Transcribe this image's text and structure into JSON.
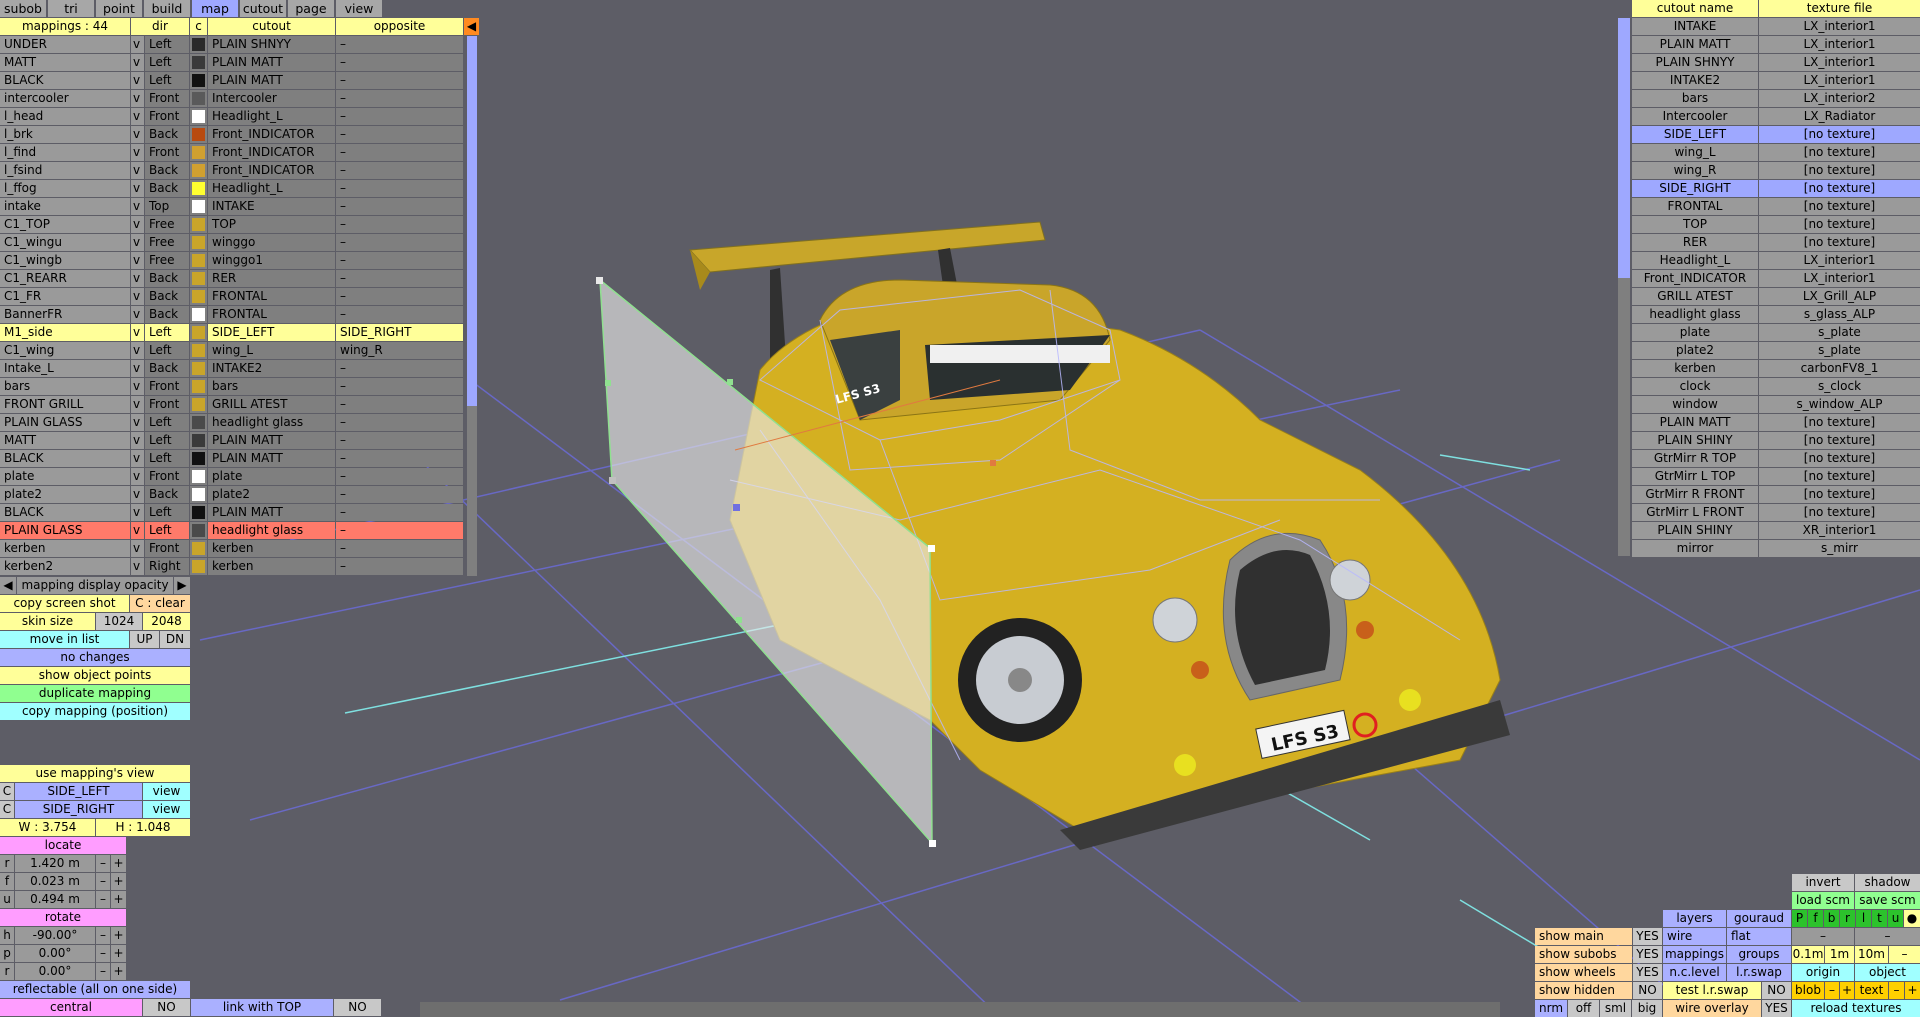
{
  "menu": {
    "tabs": [
      "subob",
      "tri",
      "point",
      "build",
      "map",
      "cutout",
      "page",
      "view"
    ],
    "active": "map"
  },
  "mappings": {
    "header": {
      "count": "mappings : 44",
      "dir": "dir",
      "c": "c",
      "cutout": "cutout",
      "opposite": "opposite"
    },
    "rows": [
      {
        "name": "UNDER",
        "v": "v",
        "dir": "Left",
        "color": "#2a2a2a",
        "cutout": "PLAIN SHNYY",
        "opp": "–"
      },
      {
        "name": "MATT",
        "v": "v",
        "dir": "Left",
        "color": "#3a3a3a",
        "cutout": "PLAIN MATT",
        "opp": "–"
      },
      {
        "name": "BLACK",
        "v": "v",
        "dir": "Left",
        "color": "#111111",
        "cutout": "PLAIN MATT",
        "opp": "–"
      },
      {
        "name": "intercooler",
        "v": "v",
        "dir": "Front",
        "color": "#5a5a5a",
        "cutout": "Intercooler",
        "opp": "–"
      },
      {
        "name": "l_head",
        "v": "v",
        "dir": "Front",
        "color": "#ffffff",
        "cutout": "Headlight_L",
        "opp": "–"
      },
      {
        "name": "l_brk",
        "v": "v",
        "dir": "Back",
        "color": "#b84a10",
        "cutout": "Front_INDICATOR",
        "opp": "–"
      },
      {
        "name": "l_find",
        "v": "v",
        "dir": "Front",
        "color": "#d0a030",
        "cutout": "Front_INDICATOR",
        "opp": "–"
      },
      {
        "name": "l_fsind",
        "v": "v",
        "dir": "Back",
        "color": "#d0a030",
        "cutout": "Front_INDICATOR",
        "opp": "–"
      },
      {
        "name": "l_ffog",
        "v": "v",
        "dir": "Back",
        "color": "#ffff30",
        "cutout": "Headlight_L",
        "opp": "–"
      },
      {
        "name": "intake",
        "v": "v",
        "dir": "Top",
        "color": "#ffffff",
        "cutout": "INTAKE",
        "opp": "–"
      },
      {
        "name": "C1_TOP",
        "v": "v",
        "dir": "Free",
        "color": "#c9a52a",
        "cutout": "TOP",
        "opp": "–"
      },
      {
        "name": "C1_wingu",
        "v": "v",
        "dir": "Free",
        "color": "#c9a52a",
        "cutout": "winggo",
        "opp": "–"
      },
      {
        "name": "C1_wingb",
        "v": "v",
        "dir": "Free",
        "color": "#c9a52a",
        "cutout": "winggo1",
        "opp": "–"
      },
      {
        "name": "C1_REARR",
        "v": "v",
        "dir": "Back",
        "color": "#c9a52a",
        "cutout": "RER",
        "opp": "–"
      },
      {
        "name": "C1_FR",
        "v": "v",
        "dir": "Back",
        "color": "#c9a52a",
        "cutout": "FRONTAL",
        "opp": "–"
      },
      {
        "name": "BannerFR",
        "v": "v",
        "dir": "Back",
        "color": "#ffffff",
        "cutout": "FRONTAL",
        "opp": "–"
      },
      {
        "name": "M1_side",
        "v": "v",
        "dir": "Left",
        "color": "#c9a52a",
        "cutout": "SIDE_LEFT",
        "opp": "SIDE_RIGHT",
        "hl": "yellow"
      },
      {
        "name": "C1_wing",
        "v": "v",
        "dir": "Left",
        "color": "#c9a52a",
        "cutout": "wing_L",
        "opp": "wing_R"
      },
      {
        "name": "Intake_L",
        "v": "v",
        "dir": "Back",
        "color": "#c9a52a",
        "cutout": "INTAKE2",
        "opp": "–"
      },
      {
        "name": "bars",
        "v": "v",
        "dir": "Front",
        "color": "#c9a52a",
        "cutout": "bars",
        "opp": "–"
      },
      {
        "name": "FRONT GRILL",
        "v": "v",
        "dir": "Front",
        "color": "#c9a52a",
        "cutout": "GRILL ATEST",
        "opp": "–"
      },
      {
        "name": "PLAIN GLASS",
        "v": "v",
        "dir": "Left",
        "color": "#4a4a4a",
        "cutout": "headlight glass",
        "opp": "–"
      },
      {
        "name": "MATT",
        "v": "v",
        "dir": "Left",
        "color": "#3a3a3a",
        "cutout": "PLAIN MATT",
        "opp": "–"
      },
      {
        "name": "BLACK",
        "v": "v",
        "dir": "Left",
        "color": "#111111",
        "cutout": "PLAIN MATT",
        "opp": "–"
      },
      {
        "name": "plate",
        "v": "v",
        "dir": "Front",
        "color": "#ffffff",
        "cutout": "plate",
        "opp": "–"
      },
      {
        "name": "plate2",
        "v": "v",
        "dir": "Back",
        "color": "#ffffff",
        "cutout": "plate2",
        "opp": "–"
      },
      {
        "name": "BLACK",
        "v": "v",
        "dir": "Left",
        "color": "#111111",
        "cutout": "PLAIN MATT",
        "opp": "–"
      },
      {
        "name": "PLAIN GLASS",
        "v": "v",
        "dir": "Left",
        "color": "#4a4a4a",
        "cutout": "headlight glass",
        "opp": "–",
        "hl": "red"
      },
      {
        "name": "kerben",
        "v": "v",
        "dir": "Front",
        "color": "#c9a52a",
        "cutout": "kerben",
        "opp": "–"
      },
      {
        "name": "kerben2",
        "v": "v",
        "dir": "Right",
        "color": "#c9a52a",
        "cutout": "kerben",
        "opp": "–"
      }
    ]
  },
  "left_panel": {
    "opacity_label": "mapping display opacity",
    "copy_screen_shot": "copy screen shot",
    "c_clear": "C : clear",
    "skin_size": "skin size",
    "skin_1024": "1024",
    "skin_2048": "2048",
    "move_in_list": "move in list",
    "up": "UP",
    "dn": "DN",
    "no_changes": "no changes",
    "show_object_points": "show object points",
    "duplicate_mapping": "duplicate mapping",
    "copy_mapping": "copy mapping (position)",
    "use_mappings_view": "use mapping's view",
    "c": "C",
    "side_left": "SIDE_LEFT",
    "side_right": "SIDE_RIGHT",
    "view": "view",
    "w": "W : 3.754",
    "h": "H : 1.048",
    "locate": "locate",
    "loc_r_label": "r",
    "loc_r": "1.420 m",
    "loc_f_label": "f",
    "loc_f": "0.023 m",
    "loc_u_label": "u",
    "loc_u": "0.494 m",
    "rotate": "rotate",
    "rot_h_label": "h",
    "rot_h": "-90.00°",
    "rot_p_label": "p",
    "rot_p": "0.00°",
    "rot_r_label": "r",
    "rot_r": "0.00°",
    "minus": "–",
    "plus": "+",
    "reflectable": "reflectable (all on one side)",
    "central": "central",
    "central_val": "NO",
    "link_with_top": "link with TOP",
    "link_val": "NO"
  },
  "textures": {
    "header": {
      "name": "cutout name",
      "file": "texture file"
    },
    "rows": [
      {
        "name": "INTAKE",
        "file": "LX_interior1"
      },
      {
        "name": "PLAIN MATT",
        "file": "LX_interior1"
      },
      {
        "name": "PLAIN SHNYY",
        "file": "LX_interior1"
      },
      {
        "name": "INTAKE2",
        "file": "LX_interior1"
      },
      {
        "name": "bars",
        "file": "LX_interior2"
      },
      {
        "name": "Intercooler",
        "file": "LX_Radiator"
      },
      {
        "name": "SIDE_LEFT",
        "file": "[no texture]",
        "hl": true
      },
      {
        "name": "wing_L",
        "file": "[no texture]"
      },
      {
        "name": "wing_R",
        "file": "[no texture]"
      },
      {
        "name": "SIDE_RIGHT",
        "file": "[no texture]",
        "hl": true
      },
      {
        "name": "FRONTAL",
        "file": "[no texture]"
      },
      {
        "name": "TOP",
        "file": "[no texture]"
      },
      {
        "name": "RER",
        "file": "[no texture]"
      },
      {
        "name": "Headlight_L",
        "file": "LX_interior1"
      },
      {
        "name": "Front_INDICATOR",
        "file": "LX_interior1"
      },
      {
        "name": "GRILL ATEST",
        "file": "LX_Grill_ALP"
      },
      {
        "name": "headlight glass",
        "file": "s_glass_ALP"
      },
      {
        "name": "plate",
        "file": "s_plate"
      },
      {
        "name": "plate2",
        "file": "s_plate"
      },
      {
        "name": "kerben",
        "file": "carbonFV8_1"
      },
      {
        "name": "clock",
        "file": "s_clock"
      },
      {
        "name": "window",
        "file": "s_window_ALP"
      },
      {
        "name": "PLAIN MATT",
        "file": "[no texture]"
      },
      {
        "name": "PLAIN SHINY",
        "file": "[no texture]"
      },
      {
        "name": "GtrMirr R TOP",
        "file": "[no texture]"
      },
      {
        "name": "GtrMirr L TOP",
        "file": "[no texture]"
      },
      {
        "name": "GtrMirr R FRONT",
        "file": "[no texture]"
      },
      {
        "name": "GtrMirr L FRONT",
        "file": "[no texture]"
      },
      {
        "name": "PLAIN SHINY",
        "file": "XR_interior1"
      },
      {
        "name": "mirror",
        "file": "s_mirr"
      }
    ]
  },
  "bottom_right": {
    "invert": "invert",
    "shadow": "shadow",
    "load_scm": "load scm",
    "save_scm": "save scm",
    "layers": "layers",
    "gouraud": "gouraud",
    "letters": [
      "P",
      "f",
      "b",
      "r",
      "l",
      "t",
      "u"
    ],
    "dot": "●",
    "wire": "wire",
    "flat": "flat",
    "show_main": "show main",
    "show_main_val": "YES",
    "show_subobs": "show subobs",
    "show_subobs_val": "YES",
    "mappings": "mappings",
    "groups": "groups",
    "g01": "0.1m",
    "g1": "1m",
    "g10": "10m",
    "show_wheels": "show wheels",
    "show_wheels_val": "YES",
    "nclevel": "n.c.level",
    "lrswap": "l.r.swap",
    "origin": "origin",
    "object": "object",
    "show_hidden": "show hidden",
    "show_hidden_val": "NO",
    "test_lrswap": "test l.r.swap",
    "test_lrswap_val": "NO",
    "blob": "blob",
    "text": "text",
    "minus": "–",
    "plus": "+",
    "nrm": "nrm",
    "off": "off",
    "sml": "sml",
    "big": "big",
    "wire_overlay": "wire overlay",
    "wire_overlay_val": "YES",
    "reload_textures": "reload textures"
  },
  "car": {
    "plate_text": "LFS S3",
    "side_text": "LFS S3"
  }
}
